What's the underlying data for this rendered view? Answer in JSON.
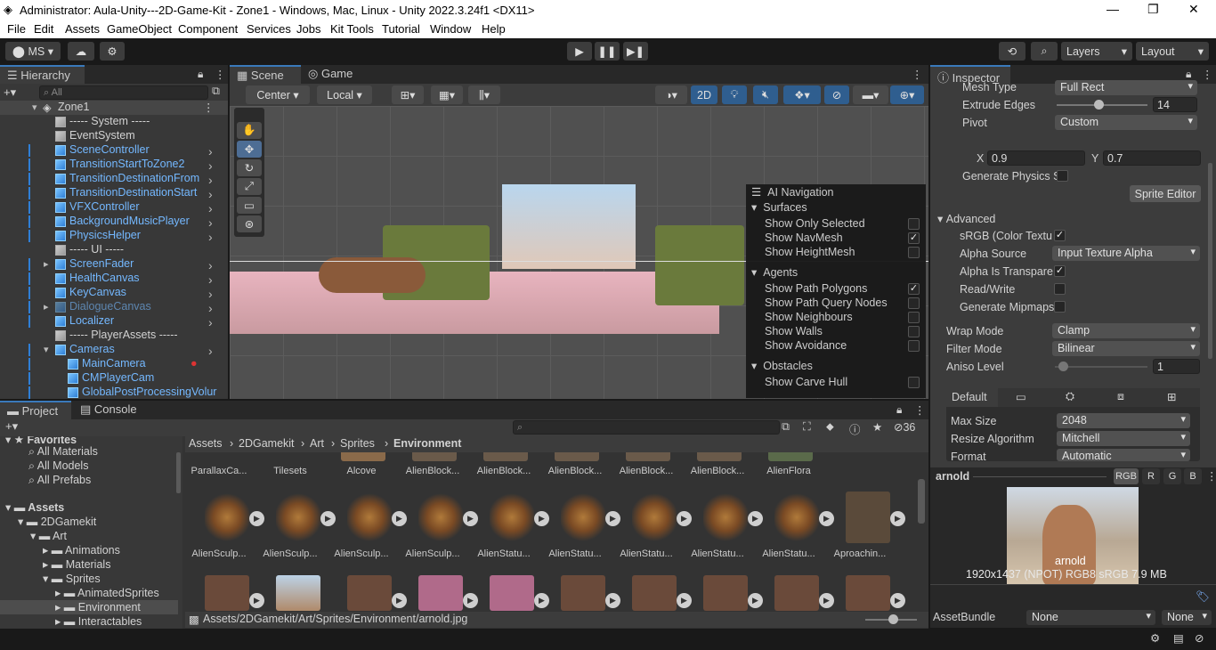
{
  "window": {
    "title": "Administrator: Aula-Unity---2D-Game-Kit - Zone1 - Windows, Mac, Linux - Unity 2022.3.24f1 <DX11>"
  },
  "menu": [
    "File",
    "Edit",
    "Assets",
    "GameObject",
    "Component",
    "Services",
    "Jobs",
    "Kit Tools",
    "Tutorial",
    "Window",
    "Help"
  ],
  "toolbar": {
    "account": "MS",
    "layers": "Layers",
    "layout": "Layout"
  },
  "hierarchy": {
    "tab": "Hierarchy",
    "search_placeholder": "All",
    "scene": "Zone1",
    "items": [
      "----- System -----",
      "EventSystem",
      "SceneController",
      "TransitionStartToZone2",
      "TransitionDestinationFrom",
      "TransitionDestinationStart",
      "VFXController",
      "BackgroundMusicPlayer",
      "PhysicsHelper",
      "----- UI -----",
      "ScreenFader",
      "HealthCanvas",
      "KeyCanvas",
      "DialogueCanvas",
      "Localizer",
      "----- PlayerAssets -----",
      "Cameras",
      "MainCamera",
      "CMPlayerCam",
      "GlobalPostProcessingVolur"
    ]
  },
  "scene": {
    "tabs": [
      "Scene",
      "Game"
    ],
    "pivot": "Center",
    "space": "Local",
    "mode2d": "2D"
  },
  "ai_nav": {
    "title": "AI Navigation",
    "surfaces": "Surfaces",
    "surface_items": [
      "Show Only Selected",
      "Show NavMesh",
      "Show HeightMesh"
    ],
    "agents": "Agents",
    "agent_items": [
      "Show Path Polygons",
      "Show Path Query Nodes",
      "Show Neighbours",
      "Show Walls",
      "Show Avoidance"
    ],
    "obstacles": "Obstacles",
    "obstacle_items": [
      "Show Carve Hull"
    ]
  },
  "inspector": {
    "tab": "Inspector",
    "mesh_type_label": "Mesh Type",
    "mesh_type": "Full Rect",
    "extrude_label": "Extrude Edges",
    "extrude": "14",
    "pivot_label": "Pivot",
    "pivot": "Custom",
    "x_label": "X",
    "x": "0.9",
    "y_label": "Y",
    "y": "0.7",
    "gen_physics": "Generate Physics S",
    "sprite_editor": "Sprite Editor",
    "advanced": "Advanced",
    "srgb": "sRGB (Color Textu",
    "alpha_source_label": "Alpha Source",
    "alpha_source": "Input Texture Alpha",
    "alpha_transparency": "Alpha Is Transpare",
    "read_write": "Read/Write",
    "mipmaps": "Generate Mipmaps",
    "wrap_label": "Wrap Mode",
    "wrap": "Clamp",
    "filter_label": "Filter Mode",
    "filter": "Bilinear",
    "aniso_label": "Aniso Level",
    "aniso": "1",
    "platform_default": "Default",
    "max_size_label": "Max Size",
    "max_size": "2048",
    "resize_label": "Resize Algorithm",
    "resize": "Mitchell",
    "format_label": "Format",
    "format": "Automatic",
    "preview_name": "arnold",
    "channels": [
      "RGB",
      "R",
      "G",
      "B"
    ],
    "preview_caption": "arnold",
    "preview_info": "1920x1437 (NPOT)  RGB8 sRGB  7.9 MB",
    "assetbundle_label": "AssetBundle",
    "assetbundle": "None",
    "variant": "None"
  },
  "project": {
    "tabs": [
      "Project",
      "Console"
    ],
    "hidden_count": "36",
    "favorites": "Favorites",
    "fav_items": [
      "All Materials",
      "All Models",
      "All Prefabs"
    ],
    "assets": "Assets",
    "tree": [
      "2DGamekit",
      "Art",
      "Animations",
      "Materials",
      "Sprites",
      "AnimatedSprites",
      "Environment",
      "Interactables"
    ],
    "breadcrumb": [
      "Assets",
      "2DGamekit",
      "Art",
      "Sprites",
      "Environment"
    ],
    "row1": [
      "ParallaxCa...",
      "Tilesets",
      "Alcove",
      "AlienBlock...",
      "AlienBlock...",
      "AlienBlock...",
      "AlienBlock...",
      "AlienBlock...",
      "AlienFlora"
    ],
    "row2": [
      "AlienSculp...",
      "AlienSculp...",
      "AlienSculp...",
      "AlienSculp...",
      "AlienStatu...",
      "AlienStatu...",
      "AlienStatu...",
      "AlienStatu...",
      "AlienStatu...",
      "Aproachin..."
    ],
    "path": "Assets/2DGamekit/Art/Sprites/Environment/arnold.jpg"
  }
}
